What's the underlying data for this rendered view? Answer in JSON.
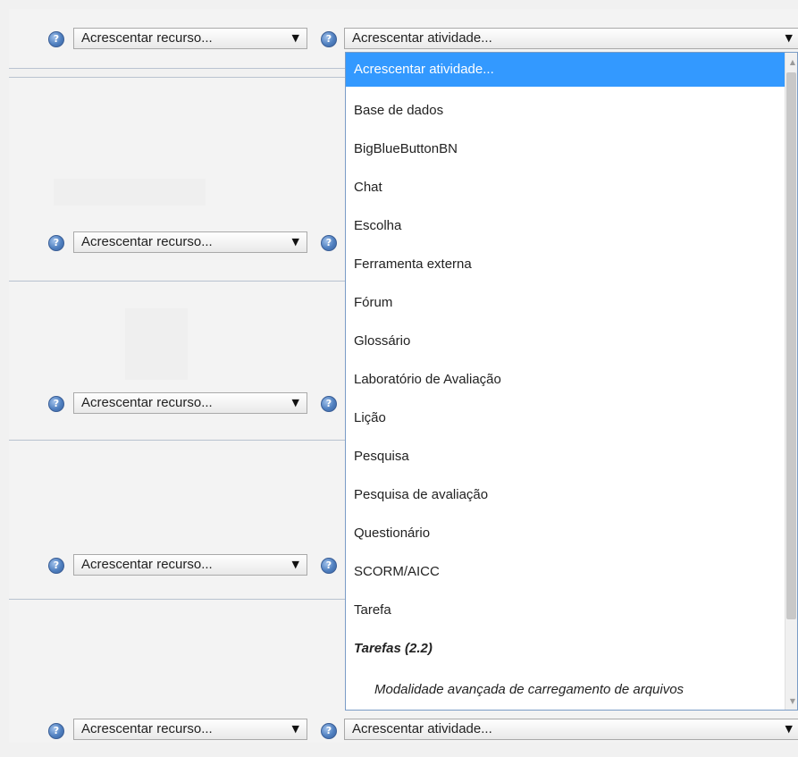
{
  "resource_select": {
    "label": "Acrescentar recurso...",
    "arrow": "▼"
  },
  "activity_select": {
    "label": "Acrescentar atividade...",
    "arrow": "▼"
  },
  "help_icon": {
    "glyph": "?",
    "icon": "help-icon"
  },
  "dropdown": {
    "options": [
      {
        "label": "Acrescentar atividade...",
        "selected": true
      },
      {
        "label": "Base de dados"
      },
      {
        "label": "BigBlueButtonBN"
      },
      {
        "label": "Chat"
      },
      {
        "label": "Escolha"
      },
      {
        "label": "Ferramenta externa"
      },
      {
        "label": "Fórum"
      },
      {
        "label": "Glossário"
      },
      {
        "label": "Laboratório de Avaliação"
      },
      {
        "label": "Lição"
      },
      {
        "label": "Pesquisa"
      },
      {
        "label": "Pesquisa de avaliação"
      },
      {
        "label": "Questionário"
      },
      {
        "label": "SCORM/AICC"
      },
      {
        "label": "Tarefa"
      },
      {
        "label": "Tarefas (2.2)",
        "group": true
      },
      {
        "label": "Modalidade avançada de carregamento de arquivos",
        "sub": true
      }
    ],
    "scroll_up": "▲",
    "scroll_down": "▼"
  },
  "colors": {
    "selected_bg": "#3399ff",
    "help_blue": "#4f7fbf",
    "dropdown_border": "#7a9cc6"
  }
}
